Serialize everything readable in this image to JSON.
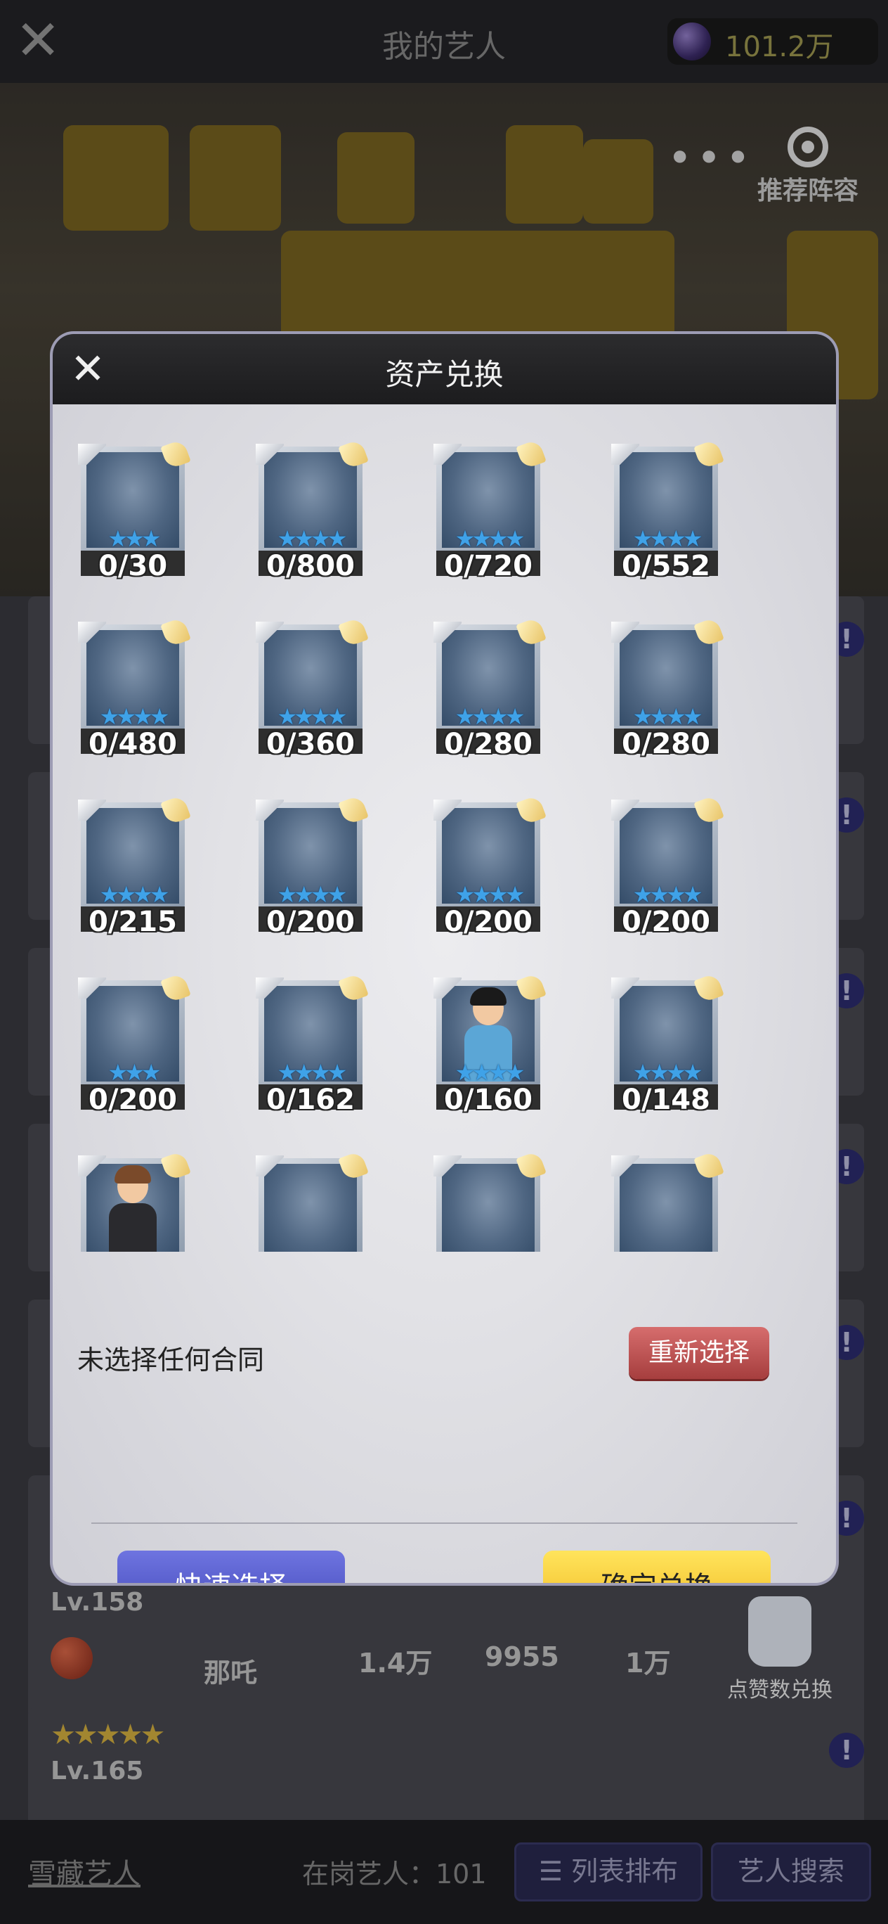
{
  "header": {
    "close_icon": "close-icon",
    "title": "我的艺人",
    "currency_amount": "101.2万"
  },
  "scene": {
    "more_dots": "•••",
    "recommend_label": "推荐阵容"
  },
  "behind_list": {
    "row_a": {
      "level": "Lv.158",
      "name": "那吒",
      "stats": [
        "1.4万",
        "9955",
        "1万"
      ]
    },
    "row_b": {
      "level": "Lv.165"
    },
    "like_exchange_label": "点赞数兑换"
  },
  "bottom": {
    "hidden_tab": "雪藏艺人",
    "on_duty": "在岗艺人：101",
    "list_layout_btn": "列表排布",
    "search_btn": "艺人搜索"
  },
  "modal": {
    "title": "资产兑换",
    "cards": [
      {
        "count": "0/30",
        "stars": "★★★",
        "char": null
      },
      {
        "count": "0/800",
        "stars": "★★★★",
        "char": null
      },
      {
        "count": "0/720",
        "stars": "★★★★",
        "char": null
      },
      {
        "count": "0/552",
        "stars": "★★★★",
        "char": null
      },
      {
        "count": "0/480",
        "stars": "★★★★",
        "char": null
      },
      {
        "count": "0/360",
        "stars": "★★★★",
        "char": null
      },
      {
        "count": "0/280",
        "stars": "★★★★",
        "char": null
      },
      {
        "count": "0/280",
        "stars": "★★★★",
        "char": null
      },
      {
        "count": "0/215",
        "stars": "★★★★",
        "char": null
      },
      {
        "count": "0/200",
        "stars": "★★★★",
        "char": null
      },
      {
        "count": "0/200",
        "stars": "★★★★",
        "char": null
      },
      {
        "count": "0/200",
        "stars": "★★★★",
        "char": null
      },
      {
        "count": "0/200",
        "stars": "★★★",
        "char": null
      },
      {
        "count": "0/162",
        "stars": "★★★★",
        "char": null
      },
      {
        "count": "0/160",
        "stars": "★★★★",
        "char": "swordsman"
      },
      {
        "count": "0/148",
        "stars": "★★★★",
        "char": null
      },
      {
        "count": "",
        "stars": "",
        "char": "girl"
      },
      {
        "count": "",
        "stars": "",
        "char": null
      },
      {
        "count": "",
        "stars": "",
        "char": null
      },
      {
        "count": "",
        "stars": "",
        "char": null
      }
    ],
    "status_text": "未选择任何合同",
    "reselect_btn": "重新选择",
    "quick_select_btn": "快速选择",
    "confirm_btn": "确定兑换"
  }
}
